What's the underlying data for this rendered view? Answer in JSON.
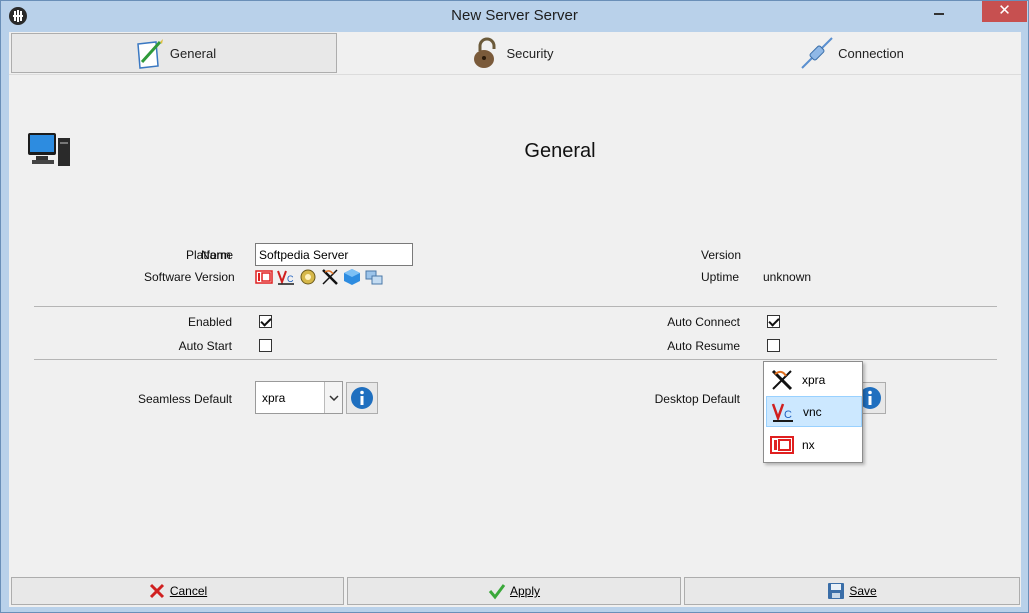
{
  "window": {
    "title": "New Server Server",
    "close_glyph": "✕"
  },
  "tabs": [
    {
      "label": "General",
      "icon": "pencil-paper-icon",
      "active": true
    },
    {
      "label": "Security",
      "icon": "padlock-icon",
      "active": false
    },
    {
      "label": "Connection",
      "icon": "plug-icon",
      "active": false
    }
  ],
  "page": {
    "title": "General",
    "icon": "computer-icon"
  },
  "form": {
    "platform_label": "Platform",
    "name_label": "Name",
    "name_value": "Softpedia Server",
    "software_version_label": "Software Version",
    "version_label": "Version",
    "version_value": "",
    "uptime_label": "Uptime",
    "uptime_value": "unknown",
    "enabled_label": "Enabled",
    "enabled_checked": true,
    "auto_start_label": "Auto Start",
    "auto_start_checked": false,
    "auto_connect_label": "Auto Connect",
    "auto_connect_checked": true,
    "auto_resume_label": "Auto Resume",
    "auto_resume_checked": false,
    "seamless_default_label": "Seamless Default",
    "seamless_default_value": "xpra",
    "desktop_default_label": "Desktop Default"
  },
  "desktop_dropdown": {
    "options": [
      "xpra",
      "vnc",
      "nx"
    ],
    "selected": "vnc"
  },
  "footer": {
    "cancel": "Cancel",
    "apply": "Apply",
    "save": "Save"
  },
  "colors": {
    "titlebar": "#b9d1ea",
    "close": "#c75050",
    "selection": "#cce8ff",
    "info": "#1f6fbf"
  }
}
